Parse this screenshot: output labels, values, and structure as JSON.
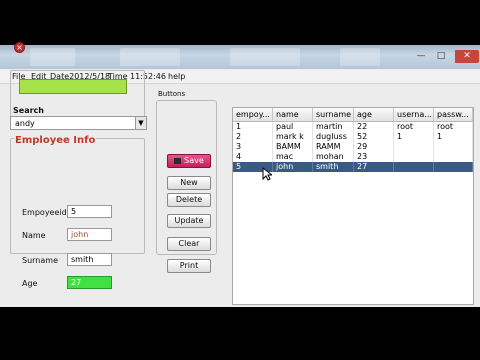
{
  "menubar": {
    "items": [
      "File",
      "Edit",
      "Date2012/5/18",
      "Time",
      "11:52:46",
      "help"
    ]
  },
  "search": {
    "title": "Search",
    "value": ""
  },
  "combo": {
    "selected": "andy"
  },
  "employee_info": {
    "title": "Employee Info",
    "fields": [
      {
        "label": "Empoyeeid",
        "value": "5"
      },
      {
        "label": "Name",
        "value": "john"
      },
      {
        "label": "Surname",
        "value": "smith"
      },
      {
        "label": "Age",
        "value": "27"
      }
    ]
  },
  "buttons": {
    "title": "Buttons",
    "save": "Save",
    "new": "New",
    "delete": "Delete",
    "update": "Update",
    "clear": "Clear",
    "print": "Print"
  },
  "table": {
    "columns": [
      "empoy...",
      "name",
      "surname",
      "age",
      "userna...",
      "passw..."
    ],
    "rows": [
      [
        "1",
        "paul",
        "martin",
        "22",
        "root",
        "root"
      ],
      [
        "2",
        "mark k",
        "dugluss",
        "52",
        "1",
        "1"
      ],
      [
        "3",
        "BAMM",
        "RAMM",
        "29",
        "",
        ""
      ],
      [
        "4",
        "mac",
        "mohan",
        "23",
        "",
        ""
      ],
      [
        "5",
        "john",
        "smith",
        "27",
        "",
        ""
      ]
    ],
    "selected_row": 4
  },
  "colors": {
    "search_field": "#a6e24a",
    "age_field": "#43e043",
    "save_button": "#d63a72",
    "selected_row": "#3a5a86",
    "info_title": "#c0392b"
  }
}
